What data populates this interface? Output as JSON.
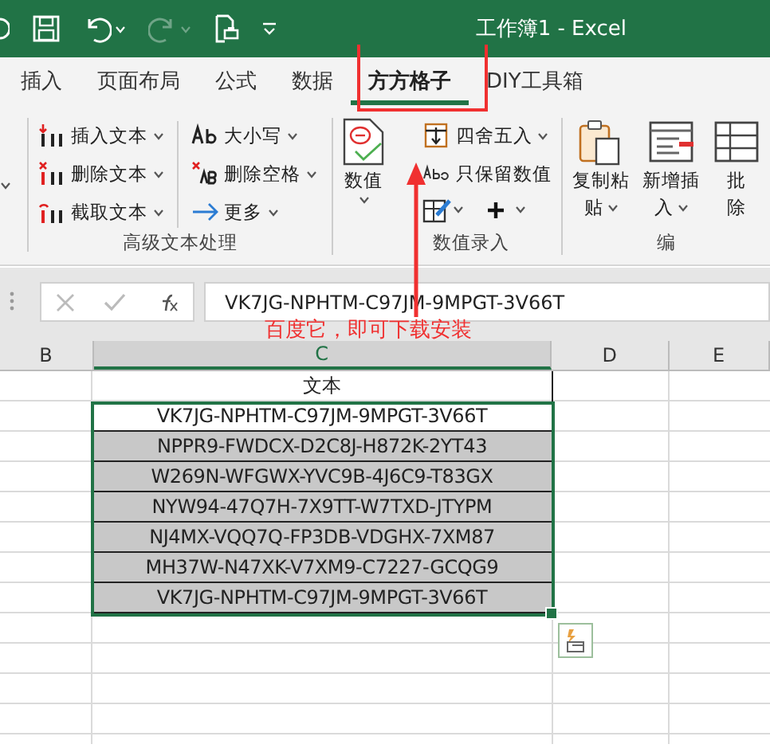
{
  "title_bar": {
    "title": "工作簿1  -  Excel",
    "redo_disabled": true
  },
  "tabs": [
    {
      "label": "插入",
      "selected": false
    },
    {
      "label": "页面布局",
      "selected": false
    },
    {
      "label": "公式",
      "selected": false
    },
    {
      "label": "数据",
      "selected": false
    },
    {
      "label": "方方格子",
      "selected": true
    },
    {
      "label": "DIY工具箱",
      "selected": false
    }
  ],
  "ribbon": {
    "text_group": {
      "label": "高级文本处理",
      "items": [
        "插入文本",
        "删除文本",
        "截取文本",
        "大小写",
        "删除空格",
        "更多"
      ]
    },
    "number_group": {
      "label": "数值录入",
      "large_button": "数值",
      "items": [
        "四舍五入",
        "只保留数值"
      ]
    },
    "edit_group": {
      "label": "编",
      "buttons": [
        [
          "复制粘",
          "贴"
        ],
        [
          "新增插",
          "入"
        ],
        [
          "批",
          "除"
        ]
      ]
    }
  },
  "formula_bar": {
    "value": "VK7JG-NPHTM-C97JM-9MPGT-3V66T"
  },
  "columns": [
    "B",
    "C",
    "D",
    "E"
  ],
  "header_cell": "文本",
  "rows": [
    {
      "text": "VK7JG-NPHTM-C97JM-9MPGT-3V66T",
      "highlighted": false
    },
    {
      "text": "NPPR9-FWDCX-D2C8J-H872K-2YT43",
      "highlighted": true
    },
    {
      "text": "W269N-WFGWX-YVC9B-4J6C9-T83GX",
      "highlighted": true
    },
    {
      "text": "NYW94-47Q7H-7X9TT-W7TXD-JTYPM",
      "highlighted": true
    },
    {
      "text": "NJ4MX-VQQ7Q-FP3DB-VDGHX-7XM87",
      "highlighted": true
    },
    {
      "text": "MH37W-N47XK-V7XM9-C7227-GCQG9",
      "highlighted": true
    },
    {
      "text": "VK7JG-NPHTM-C97JM-9MPGT-3V66T",
      "highlighted": true
    }
  ],
  "annotation": {
    "callout": "百度它，即可下载安装"
  }
}
